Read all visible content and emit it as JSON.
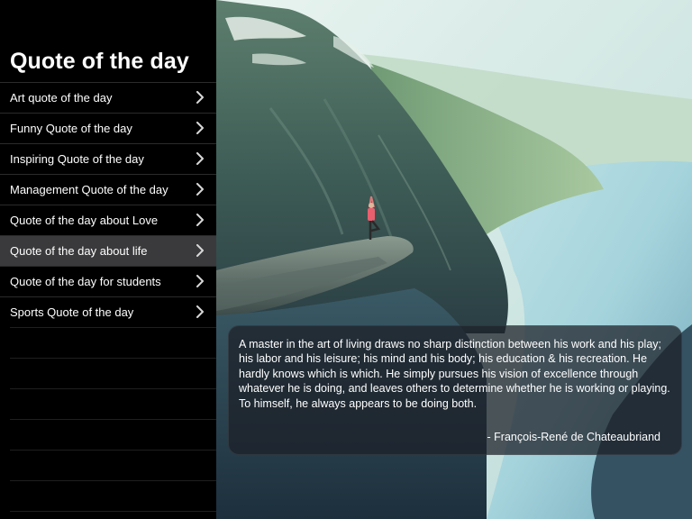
{
  "sidebar": {
    "title": "Quote of the day",
    "items": [
      {
        "label": "Art quote of the day"
      },
      {
        "label": "Funny Quote of the day"
      },
      {
        "label": "Inspiring Quote of the day"
      },
      {
        "label": "Management Quote of the day"
      },
      {
        "label": "Quote of the day about Love"
      },
      {
        "label": "Quote of the day about life"
      },
      {
        "label": "Quote of the day for students"
      },
      {
        "label": "Sports Quote of the day"
      }
    ],
    "selected_label": "Quote of the day about life",
    "chevron_icon": "chevron-right-icon"
  },
  "quote": {
    "text": "A master in the art of living draws no sharp distinction between his work and his play; his labor and his leisure; his mind and his body; his education & his recreation. He hardly knows which is which. He simply pursues his vision of excellence through whatever he is doing, and leaves others to determine whether he is working or playing. To himself, he always appears to be doing both.",
    "author": "-  François-René de Chateaubriand"
  },
  "colors": {
    "sidebar_bg": "#000000",
    "selected_row": "#3a3a3c",
    "text": "#ffffff"
  }
}
